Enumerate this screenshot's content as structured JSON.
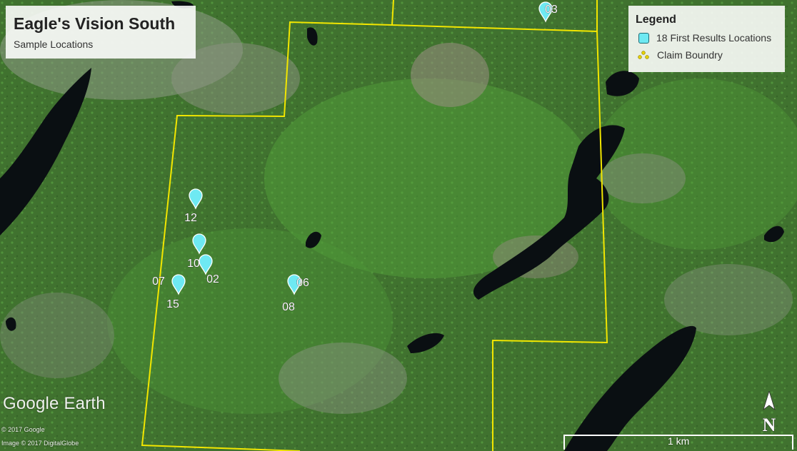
{
  "title": "Eagle's Vision South",
  "subtitle": "Sample Locations",
  "legend": {
    "title": "Legend",
    "items": [
      {
        "label": "18 First Results Locations",
        "symbol": "sample-pin",
        "color": "#6ee9f2"
      },
      {
        "label": "Claim Boundry",
        "symbol": "claim-boundary",
        "color": "#f2e600"
      }
    ]
  },
  "samples": [
    "03",
    "12",
    "10",
    "02",
    "07",
    "15",
    "06",
    "08"
  ],
  "branding": "Google Earth",
  "copyright": [
    "© 2017 Google",
    "Image © 2017 DigitalGlobe"
  ],
  "scale_label": "1 km",
  "north_label": "N",
  "colors": {
    "boundary": "#f2e600",
    "pin": "#6ee9f2",
    "water": "#0a0f12",
    "forest": "#3f7a2e"
  }
}
